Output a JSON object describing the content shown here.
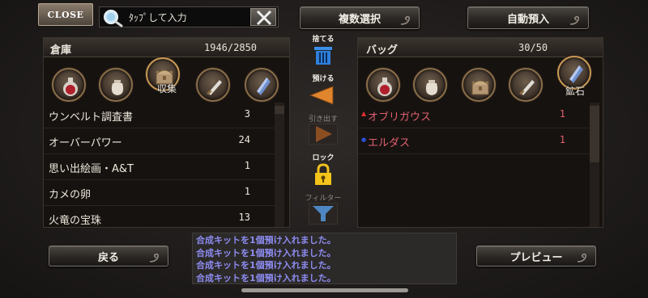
{
  "top": {
    "close_label": "CLOSE",
    "search_placeholder": "ﾀｯﾌﾟして入力",
    "multi_select_label": "複数選択",
    "auto_deposit_label": "自動預入"
  },
  "storage": {
    "title": "倉庫",
    "capacity": "1946/2850",
    "selected_category_label": "収集",
    "items": [
      {
        "name": "ウンベルト調査書",
        "count": "3"
      },
      {
        "name": "オーバーパワー",
        "count": "24"
      },
      {
        "name": "思い出絵画・A&T",
        "count": "1"
      },
      {
        "name": "カメの卵",
        "count": "1"
      },
      {
        "name": "火竜の宝珠",
        "count": "13"
      }
    ]
  },
  "bag": {
    "title": "バッグ",
    "capacity": "30/50",
    "selected_category_label": "鉱石",
    "items": [
      {
        "marker": "▲",
        "marker_color": "#e03030",
        "name": "オブリガウス",
        "count": "1"
      },
      {
        "marker": "●",
        "marker_color": "#2c50e0",
        "name": "エルダス",
        "count": "1"
      }
    ]
  },
  "middle": {
    "discard_label": "捨てる",
    "deposit_label": "預ける",
    "withdraw_label": "引き出す",
    "lock_label": "ロック",
    "filter_label": "フィルター"
  },
  "bottom": {
    "back_label": "戻る",
    "preview_label": "プレビュー",
    "log_lines": [
      "合成キットを1個預け入れました。",
      "合成キットを1個預け入れました。",
      "合成キットを1個預け入れました。",
      "合成キットを1個預け入れました。"
    ]
  },
  "colors": {
    "bag_item_text": "#e06070",
    "log_text": "#8e8cf2"
  }
}
